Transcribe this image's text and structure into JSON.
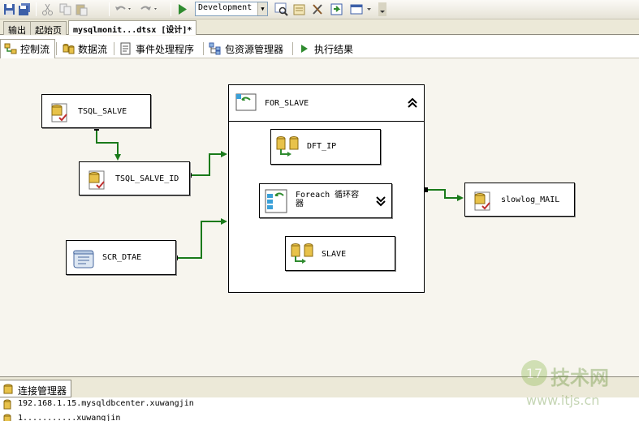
{
  "toolbar": {
    "configuration": "Development",
    "buttons": [
      "save-icon",
      "save-all-icon",
      "cut-icon",
      "copy-icon",
      "paste-icon",
      "undo-icon",
      "redo-icon",
      "start-debugging-icon",
      "find-icon",
      "properties-icon",
      "toolbox-icon",
      "solution-explorer-icon",
      "window-icon"
    ]
  },
  "doc_tabs": [
    {
      "label": "输出"
    },
    {
      "label": "起始页"
    },
    {
      "label": "mysqlmonit...dtsx [设计]*"
    }
  ],
  "designer_tabs": [
    {
      "label": "控制流"
    },
    {
      "label": "数据流"
    },
    {
      "label": "事件处理程序"
    },
    {
      "label": "包资源管理器"
    },
    {
      "label": "执行结果"
    }
  ],
  "canvas": {
    "tasks": {
      "tsql_salve": "TSQL_SALVE",
      "tsql_salve_id": "TSQL_SALVE_ID",
      "scr_dtae": "SCR_DTAE",
      "for_slave": "FOR_SLAVE",
      "dft_ip": "DFT_IP",
      "foreach": "Foreach 循环容器",
      "slave": "SLAVE",
      "slowlog_mail": "slowlog_MAIL"
    },
    "connector_color": "#1a7a1a"
  },
  "connection_manager": {
    "tab_label": "连接管理器",
    "items": [
      "192.168.1.15.mysqldbcenter.xuwangjin",
      "1...........xuwangjin"
    ]
  },
  "watermark": {
    "text1": "技术网",
    "text2": "www.itjs.cn"
  }
}
